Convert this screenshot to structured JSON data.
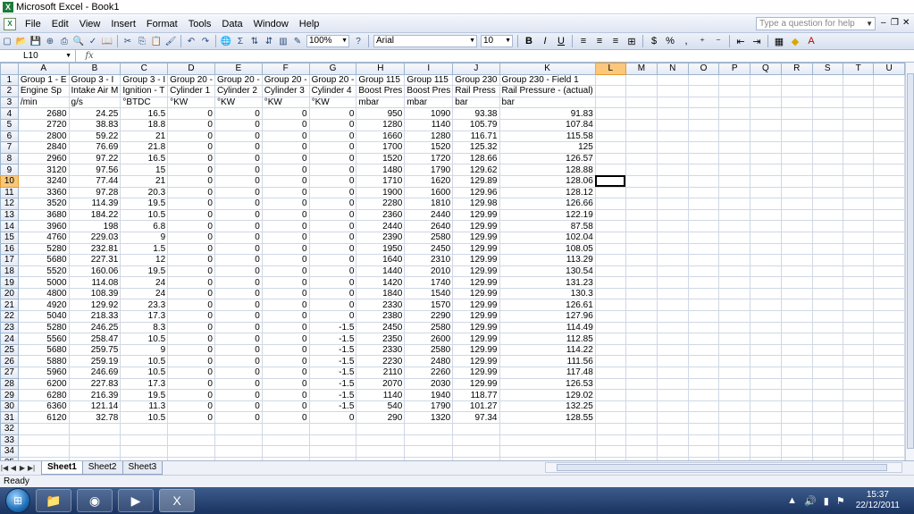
{
  "window": {
    "title": "Microsoft Excel - Book1"
  },
  "menu": {
    "items": [
      "File",
      "Edit",
      "View",
      "Insert",
      "Format",
      "Tools",
      "Data",
      "Window",
      "Help"
    ],
    "help_placeholder": "Type a question for help"
  },
  "toolbar": {
    "zoom": "100%",
    "font": "Arial",
    "font_size": "10"
  },
  "formula_bar": {
    "name_box": "L10",
    "fx_label": "fx",
    "content": ""
  },
  "columns": [
    "A",
    "B",
    "C",
    "D",
    "E",
    "F",
    "G",
    "H",
    "I",
    "J",
    "K",
    "L",
    "M",
    "N",
    "O",
    "P",
    "Q",
    "R",
    "S",
    "T",
    "U"
  ],
  "active_cell": {
    "col": "L",
    "row": 10
  },
  "rows": [
    [
      "Group 1 - E",
      "Group 3 - I",
      "Group 3 - I",
      "Group 20 -",
      "Group 20 -",
      "Group 20 -",
      "Group 20 -",
      "Group 115",
      "Group 115",
      "Group 230",
      "Group 230 - Field 1"
    ],
    [
      "Engine Sp",
      "Intake Air M",
      "Ignition - T",
      "Cylinder 1",
      "Cylinder 2",
      "Cylinder 3",
      "Cylinder 4",
      "Boost Pres",
      "Boost Pres",
      "Rail Press",
      "Rail Pressure - (actual)"
    ],
    [
      "/min",
      "g/s",
      "°BTDC",
      "°KW",
      "°KW",
      "°KW",
      "°KW",
      "mbar",
      "mbar",
      "bar",
      "bar"
    ],
    [
      "2680",
      "24.25",
      "16.5",
      "0",
      "0",
      "0",
      "0",
      "950",
      "1090",
      "93.38",
      "91.83"
    ],
    [
      "2720",
      "38.83",
      "18.8",
      "0",
      "0",
      "0",
      "0",
      "1280",
      "1140",
      "105.79",
      "107.84"
    ],
    [
      "2800",
      "59.22",
      "21",
      "0",
      "0",
      "0",
      "0",
      "1660",
      "1280",
      "116.71",
      "115.58"
    ],
    [
      "2840",
      "76.69",
      "21.8",
      "0",
      "0",
      "0",
      "0",
      "1700",
      "1520",
      "125.32",
      "125"
    ],
    [
      "2960",
      "97.22",
      "16.5",
      "0",
      "0",
      "0",
      "0",
      "1520",
      "1720",
      "128.66",
      "126.57"
    ],
    [
      "3120",
      "97.56",
      "15",
      "0",
      "0",
      "0",
      "0",
      "1480",
      "1790",
      "129.62",
      "128.88"
    ],
    [
      "3240",
      "77.44",
      "21",
      "0",
      "0",
      "0",
      "0",
      "1710",
      "1620",
      "129.89",
      "128.06"
    ],
    [
      "3360",
      "97.28",
      "20.3",
      "0",
      "0",
      "0",
      "0",
      "1900",
      "1600",
      "129.96",
      "128.12"
    ],
    [
      "3520",
      "114.39",
      "19.5",
      "0",
      "0",
      "0",
      "0",
      "2280",
      "1810",
      "129.98",
      "126.66"
    ],
    [
      "3680",
      "184.22",
      "10.5",
      "0",
      "0",
      "0",
      "0",
      "2360",
      "2440",
      "129.99",
      "122.19"
    ],
    [
      "3960",
      "198",
      "6.8",
      "0",
      "0",
      "0",
      "0",
      "2440",
      "2640",
      "129.99",
      "87.58"
    ],
    [
      "4760",
      "229.03",
      "9",
      "0",
      "0",
      "0",
      "0",
      "2390",
      "2580",
      "129.99",
      "102.04"
    ],
    [
      "5280",
      "232.81",
      "1.5",
      "0",
      "0",
      "0",
      "0",
      "1950",
      "2450",
      "129.99",
      "108.05"
    ],
    [
      "5680",
      "227.31",
      "12",
      "0",
      "0",
      "0",
      "0",
      "1640",
      "2310",
      "129.99",
      "113.29"
    ],
    [
      "5520",
      "160.06",
      "19.5",
      "0",
      "0",
      "0",
      "0",
      "1440",
      "2010",
      "129.99",
      "130.54"
    ],
    [
      "5000",
      "114.08",
      "24",
      "0",
      "0",
      "0",
      "0",
      "1420",
      "1740",
      "129.99",
      "131.23"
    ],
    [
      "4800",
      "108.39",
      "24",
      "0",
      "0",
      "0",
      "0",
      "1840",
      "1540",
      "129.99",
      "130.3"
    ],
    [
      "4920",
      "129.92",
      "23.3",
      "0",
      "0",
      "0",
      "0",
      "2330",
      "1570",
      "129.99",
      "126.61"
    ],
    [
      "5040",
      "218.33",
      "17.3",
      "0",
      "0",
      "0",
      "0",
      "2380",
      "2290",
      "129.99",
      "127.96"
    ],
    [
      "5280",
      "246.25",
      "8.3",
      "0",
      "0",
      "0",
      "-1.5",
      "2450",
      "2580",
      "129.99",
      "114.49"
    ],
    [
      "5560",
      "258.47",
      "10.5",
      "0",
      "0",
      "0",
      "-1.5",
      "2350",
      "2600",
      "129.99",
      "112.85"
    ],
    [
      "5680",
      "259.75",
      "9",
      "0",
      "0",
      "0",
      "-1.5",
      "2330",
      "2580",
      "129.99",
      "114.22"
    ],
    [
      "5880",
      "259.19",
      "10.5",
      "0",
      "0",
      "0",
      "-1.5",
      "2230",
      "2480",
      "129.99",
      "111.56"
    ],
    [
      "5960",
      "246.69",
      "10.5",
      "0",
      "0",
      "0",
      "-1.5",
      "2110",
      "2260",
      "129.99",
      "117.48"
    ],
    [
      "6200",
      "227.83",
      "17.3",
      "0",
      "0",
      "0",
      "-1.5",
      "2070",
      "2030",
      "129.99",
      "126.53"
    ],
    [
      "6280",
      "216.39",
      "19.5",
      "0",
      "0",
      "0",
      "-1.5",
      "1140",
      "1940",
      "118.77",
      "129.02"
    ],
    [
      "6360",
      "121.14",
      "11.3",
      "0",
      "0",
      "0",
      "-1.5",
      "540",
      "1790",
      "101.27",
      "132.25"
    ],
    [
      "6120",
      "32.78",
      "10.5",
      "0",
      "0",
      "0",
      "0",
      "290",
      "1320",
      "97.34",
      "128.55"
    ],
    [],
    [],
    [],
    []
  ],
  "sheets": [
    "Sheet1",
    "Sheet2",
    "Sheet3"
  ],
  "active_sheet": "Sheet1",
  "status": "Ready",
  "taskbar": {
    "time": "15:37",
    "date": "22/12/2011"
  }
}
